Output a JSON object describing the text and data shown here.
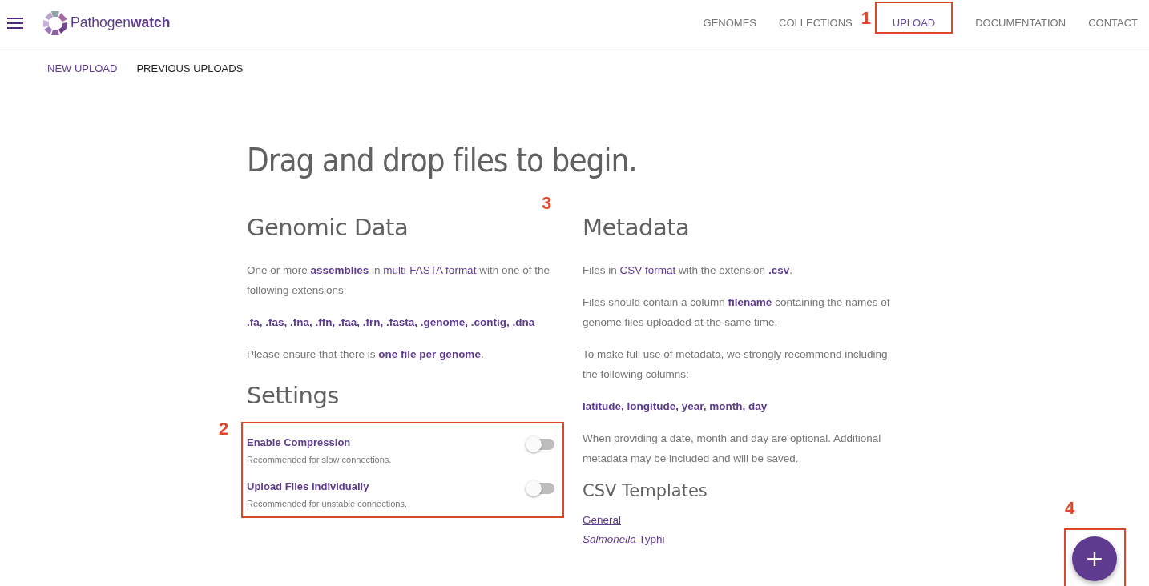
{
  "app": {
    "name_light": "Pathogen",
    "name_bold": "watch"
  },
  "nav": [
    {
      "label": "GENOMES",
      "selected": false
    },
    {
      "label": "COLLECTIONS",
      "selected": false
    },
    {
      "label": "UPLOAD",
      "selected": true,
      "callout": "1"
    },
    {
      "label": "DOCUMENTATION",
      "selected": false
    },
    {
      "label": "CONTACT",
      "selected": false
    }
  ],
  "subtabs": [
    {
      "label": "NEW UPLOAD",
      "selected": true
    },
    {
      "label": "PREVIOUS UPLOADS",
      "selected": false
    }
  ],
  "title": "Drag and drop files to begin.",
  "middle_callout": "3",
  "genomic": {
    "heading": "Genomic Data",
    "paragraphs": [
      [
        {
          "kind": "plain",
          "text": "One or more "
        },
        {
          "kind": "strong",
          "text": "assemblies"
        },
        {
          "kind": "plain",
          "text": " in "
        },
        {
          "kind": "link",
          "text": "multi-FASTA format"
        },
        {
          "kind": "plain",
          "text": " with one of the following extensions:"
        }
      ],
      [
        {
          "kind": "strong",
          "text": ".fa, .fas, .fna, .ffn, .faa, .frn, .fasta, .genome, .contig, .dna"
        }
      ],
      [
        {
          "kind": "plain",
          "text": "Please ensure that there is "
        },
        {
          "kind": "strong",
          "text": "one file per genome"
        },
        {
          "kind": "plain",
          "text": "."
        }
      ]
    ]
  },
  "settings": {
    "heading": "Settings",
    "callout": "2",
    "toggles": [
      {
        "label": "Enable Compression",
        "hint": "Recommended for slow connections.",
        "checked": false
      },
      {
        "label": "Upload Files Individually",
        "hint": "Recommended for unstable connections.",
        "checked": false
      }
    ]
  },
  "metadata": {
    "heading": "Metadata",
    "paragraphs": [
      [
        {
          "kind": "plain",
          "text": "Files in "
        },
        {
          "kind": "link",
          "text": "CSV format"
        },
        {
          "kind": "plain",
          "text": " with the extension "
        },
        {
          "kind": "strong",
          "text": ".csv"
        },
        {
          "kind": "plain",
          "text": "."
        }
      ],
      [
        {
          "kind": "plain",
          "text": "Files should contain a column "
        },
        {
          "kind": "strong",
          "text": "filename"
        },
        {
          "kind": "plain",
          "text": " containing the names of genome files uploaded at the same time."
        }
      ],
      [
        {
          "kind": "plain",
          "text": "To make full use of metadata, we strongly recommend including the following columns:"
        }
      ],
      [
        {
          "kind": "strong",
          "text": "latitude, longitude, year, month, day"
        }
      ],
      [
        {
          "kind": "plain",
          "text": "When providing a date, month and day are optional. Additional metadata may be included and will be saved."
        }
      ]
    ]
  },
  "templates": {
    "heading": "CSV Templates",
    "links": [
      "General",
      "*Salmonella* Typhi"
    ]
  },
  "fab": {
    "label": "+",
    "callout": "4"
  }
}
